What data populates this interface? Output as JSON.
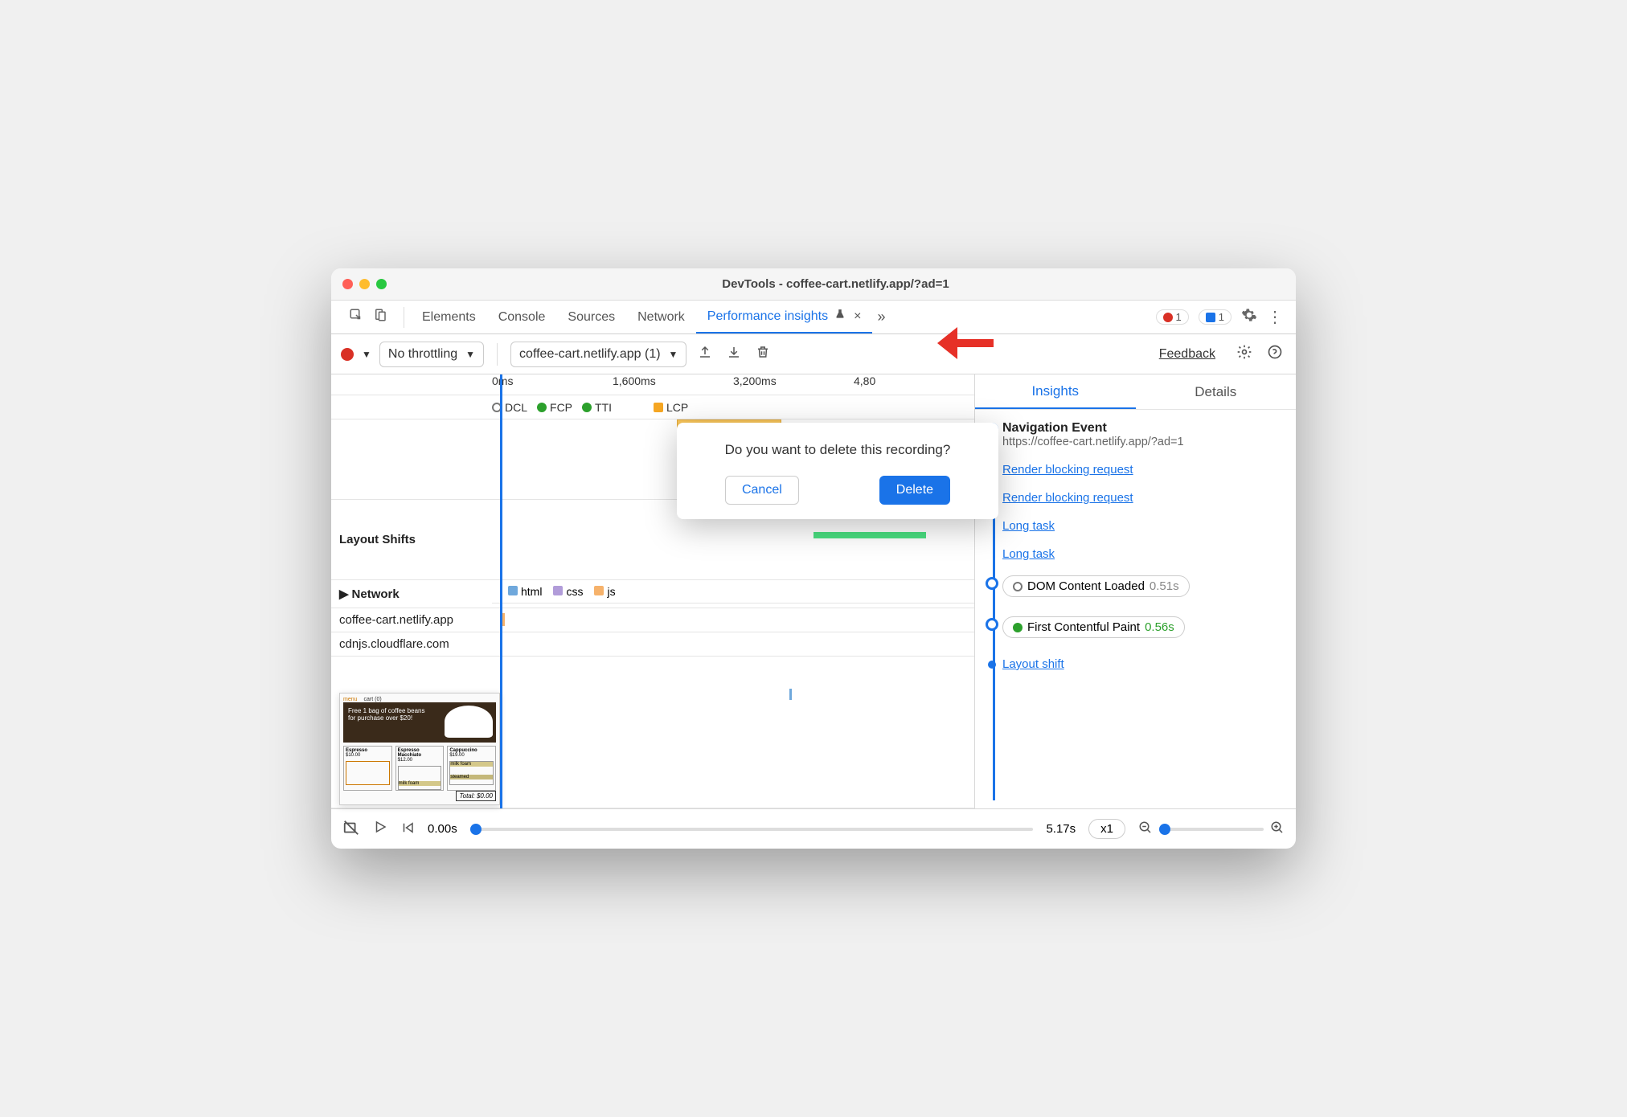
{
  "window": {
    "title": "DevTools - coffee-cart.netlify.app/?ad=1"
  },
  "tabs": {
    "items": [
      "Elements",
      "Console",
      "Sources",
      "Network",
      "Performance insights"
    ],
    "active": "Performance insights",
    "errors": "1",
    "messages": "1"
  },
  "toolbar": {
    "throttle": "No throttling",
    "recording": "coffee-cart.netlify.app (1)",
    "feedback": "Feedback"
  },
  "ruler": {
    "ticks": [
      "0ms",
      "1,600ms",
      "3,200ms",
      "4,80"
    ]
  },
  "markers": {
    "dcl": "DCL",
    "fcp": "FCP",
    "tti": "TTI",
    "lcp": "LCP"
  },
  "rows": {
    "layout_shifts": "Layout Shifts",
    "network": "Network",
    "host1": "coffee-cart.netlify.app",
    "host2": "cdnjs.cloudflare.com"
  },
  "net_legend": {
    "html": "html",
    "css": "css",
    "js": "js"
  },
  "thumb": {
    "menu": "menu",
    "cart": "cart (0)",
    "promo": "Free 1 bag of coffee beans for purchase over $20!",
    "p1": "Espresso",
    "p1p": "$10.00",
    "p2": "Espresso Macchiato",
    "p2p": "$12.00",
    "p3": "Cappuccino",
    "p3p": "$19.00",
    "milk": "milk foam",
    "steamed": "steamed",
    "total": "Total: $0.00"
  },
  "right": {
    "tab_insights": "Insights",
    "tab_details": "Details",
    "nav_title": "Navigation Event",
    "nav_url": "https://coffee-cart.netlify.app/?ad=1",
    "rbr": "Render blocking request",
    "long": "Long task",
    "dcl_label": "DOM Content Loaded",
    "dcl_time": "0.51s",
    "fcp_label": "First Contentful Paint",
    "fcp_time": "0.56s",
    "layout_shift": "Layout shift"
  },
  "footer": {
    "start": "0.00s",
    "end": "5.17s",
    "speed": "x1"
  },
  "dialog": {
    "message": "Do you want to delete this recording?",
    "cancel": "Cancel",
    "delete": "Delete"
  }
}
